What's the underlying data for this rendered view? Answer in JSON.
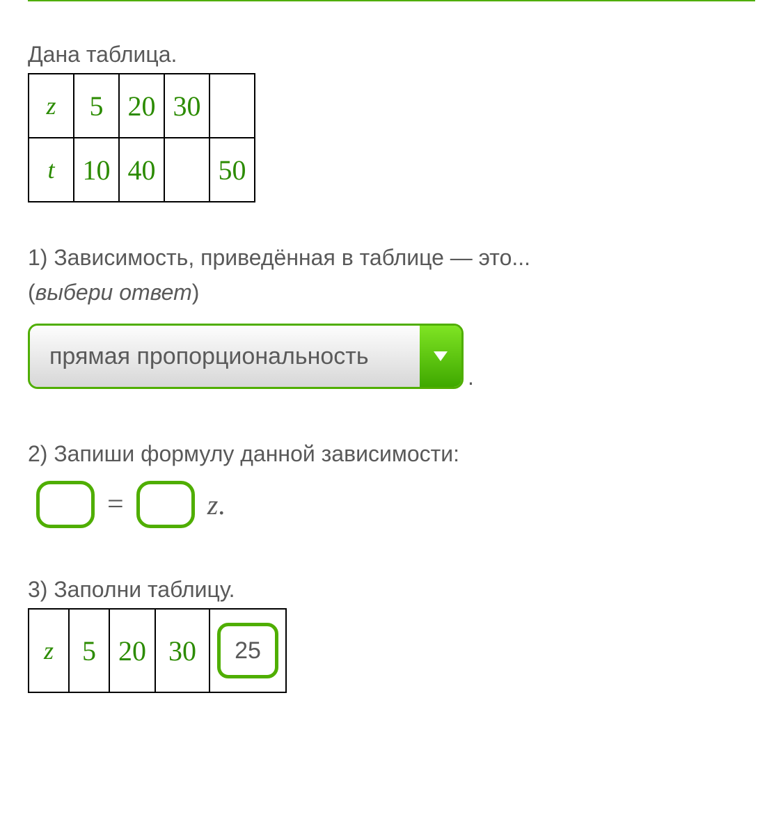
{
  "intro": "Дана таблица.",
  "table1": {
    "row1": {
      "var": "z",
      "c1": "5",
      "c2": "20",
      "c3": "30",
      "c4": ""
    },
    "row2": {
      "var": "t",
      "c1": "10",
      "c2": "40",
      "c3": "",
      "c4": "50"
    }
  },
  "q1": {
    "text": "1) Зависимость, приведённая в таблице — это...",
    "hint_open": "(",
    "hint": "выбери ответ",
    "hint_close": ")",
    "selected": "прямая пропорциональность",
    "dot": "."
  },
  "q2": {
    "text": "2) Запиши формулу данной зависимости:",
    "eq": "=",
    "var": "z",
    "dot": "."
  },
  "q3": {
    "text": "3) Заполни таблицу.",
    "row1": {
      "var": "z",
      "c1": "5",
      "c2": "20",
      "c3": "30",
      "input": "25"
    }
  }
}
